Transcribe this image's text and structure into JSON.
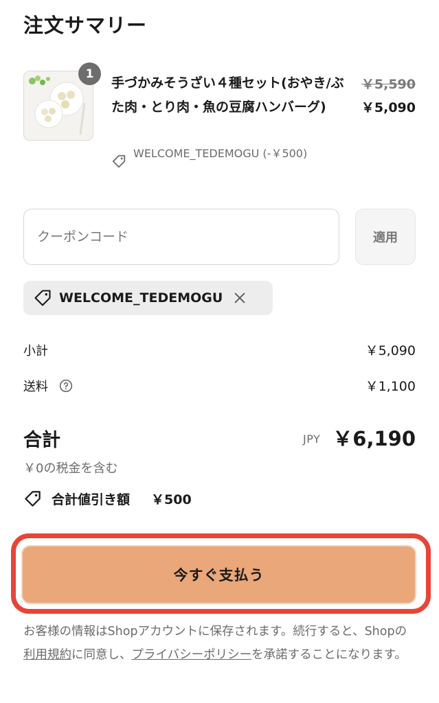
{
  "summary": {
    "title": "注文サマリー"
  },
  "product": {
    "name": "手づかみそうざい４種セット(おやき/ぶた肉・とり肉・魚の豆腐ハンバーグ)",
    "quantity": "1",
    "original_price": "￥5,590",
    "price": "￥5,090",
    "discount_line": "WELCOME_TEDEMOGU (-￥500)",
    "image_icon": "product-photo"
  },
  "coupon": {
    "placeholder": "クーポンコード",
    "value": "",
    "apply_label": "適用",
    "applied_code": "WELCOME_TEDEMOGU"
  },
  "totals": {
    "subtotal_label": "小計",
    "subtotal_value": "￥5,090",
    "shipping_label": "送料",
    "shipping_value": "￥1,100",
    "total_label": "合計",
    "currency": "JPY",
    "total_value": "￥6,190",
    "tax_note": "￥0の税金を含む",
    "savings_label": "合計値引き額",
    "savings_value": "￥500"
  },
  "pay": {
    "button_label": "今すぐ支払う"
  },
  "legal": {
    "text_1": "お客様の情報はShopアカウントに保存されます。続行すると、Shopの",
    "terms_link": "利用規約",
    "text_2": "に同意し、",
    "privacy_link": "プライバシーポリシー",
    "text_3": "を承諾することになります。"
  },
  "colors": {
    "pay_button": "#eaa77a",
    "highlight_frame": "#e64537",
    "muted_text": "#6b6b6b"
  }
}
